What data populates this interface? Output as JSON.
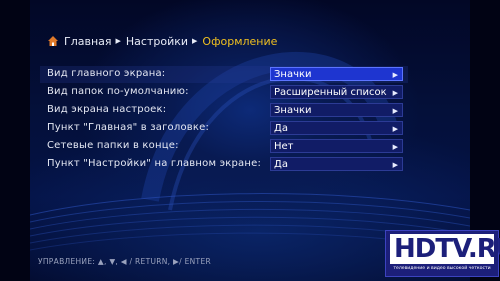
{
  "breadcrumb": {
    "home": "Главная",
    "settings": "Настройки",
    "current": "Оформление"
  },
  "settings": [
    {
      "label": "Вид главного экрана:",
      "value": "Значки",
      "selected": true
    },
    {
      "label": "Вид папок по-умолчанию:",
      "value": "Расширенный список",
      "selected": false
    },
    {
      "label": "Вид экрана настроек:",
      "value": "Значки",
      "selected": false
    },
    {
      "label": "Пункт \"Главная\" в заголовке:",
      "value": "Да",
      "selected": false
    },
    {
      "label": "Сетевые папки в конце:",
      "value": "Нет",
      "selected": false
    },
    {
      "label": "Пункт \"Настройки\" на главном экране:",
      "value": "Да",
      "selected": false
    }
  ],
  "footer": "УПРАВЛЕНИЕ:  ▲, ▼, ◀ / RETURN, ▶/ ENTER",
  "logo": {
    "text": "HDTV.RU",
    "subtitle": "телевидение и видео высокой четкости"
  },
  "colors": {
    "accent_current": "#f0c020",
    "selected_value_bg": "#1e35d0",
    "value_bg": "#111c66",
    "background": "#04103a"
  }
}
